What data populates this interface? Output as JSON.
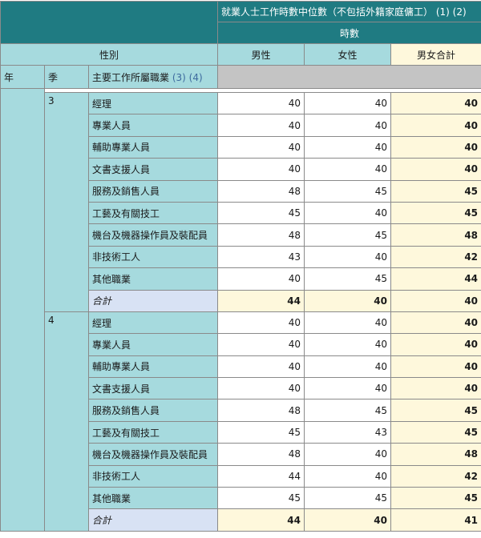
{
  "header": {
    "title": "就業人士工作時數中位數（不包括外籍家庭傭工）",
    "title_notes": "(1) (2)",
    "unit": "時數",
    "sex_label": "性別",
    "male": "男性",
    "female": "女性",
    "total": "男女合計",
    "year_label": "年",
    "quarter_label": "季",
    "occupation_label": "主要工作所屬職業",
    "occupation_notes": "(3) (4)"
  },
  "groups": [
    {
      "quarter": "3",
      "rows": [
        {
          "occupation": "經理",
          "male": "40",
          "female": "40",
          "total": "40"
        },
        {
          "occupation": "專業人員",
          "male": "40",
          "female": "40",
          "total": "40"
        },
        {
          "occupation": "輔助專業人員",
          "male": "40",
          "female": "40",
          "total": "40"
        },
        {
          "occupation": "文書支援人員",
          "male": "40",
          "female": "40",
          "total": "40"
        },
        {
          "occupation": "服務及銷售人員",
          "male": "48",
          "female": "45",
          "total": "45"
        },
        {
          "occupation": "工藝及有關技工",
          "male": "45",
          "female": "40",
          "total": "45"
        },
        {
          "occupation": "機台及機器操作員及裝配員",
          "male": "48",
          "female": "45",
          "total": "48"
        },
        {
          "occupation": "非技術工人",
          "male": "43",
          "female": "40",
          "total": "42"
        },
        {
          "occupation": "其他職業",
          "male": "40",
          "female": "45",
          "total": "44"
        }
      ],
      "subtotal": {
        "occupation": "合計",
        "male": "44",
        "female": "40",
        "total": "40"
      }
    },
    {
      "quarter": "4",
      "rows": [
        {
          "occupation": "經理",
          "male": "40",
          "female": "40",
          "total": "40"
        },
        {
          "occupation": "專業人員",
          "male": "40",
          "female": "40",
          "total": "40"
        },
        {
          "occupation": "輔助專業人員",
          "male": "40",
          "female": "40",
          "total": "40"
        },
        {
          "occupation": "文書支援人員",
          "male": "40",
          "female": "40",
          "total": "40"
        },
        {
          "occupation": "服務及銷售人員",
          "male": "48",
          "female": "45",
          "total": "45"
        },
        {
          "occupation": "工藝及有關技工",
          "male": "45",
          "female": "43",
          "total": "45"
        },
        {
          "occupation": "機台及機器操作員及裝配員",
          "male": "48",
          "female": "40",
          "total": "48"
        },
        {
          "occupation": "非技術工人",
          "male": "44",
          "female": "40",
          "total": "42"
        },
        {
          "occupation": "其他職業",
          "male": "45",
          "female": "45",
          "total": "45"
        }
      ],
      "subtotal": {
        "occupation": "合計",
        "male": "44",
        "female": "40",
        "total": "41"
      }
    }
  ],
  "colors": {
    "header_dark": "#1f7b82",
    "header_light": "#a6dade",
    "total_column": "#fef8dc",
    "subtotal_label": "#d8e2f4",
    "grey_bar": "#c4c4c4"
  }
}
